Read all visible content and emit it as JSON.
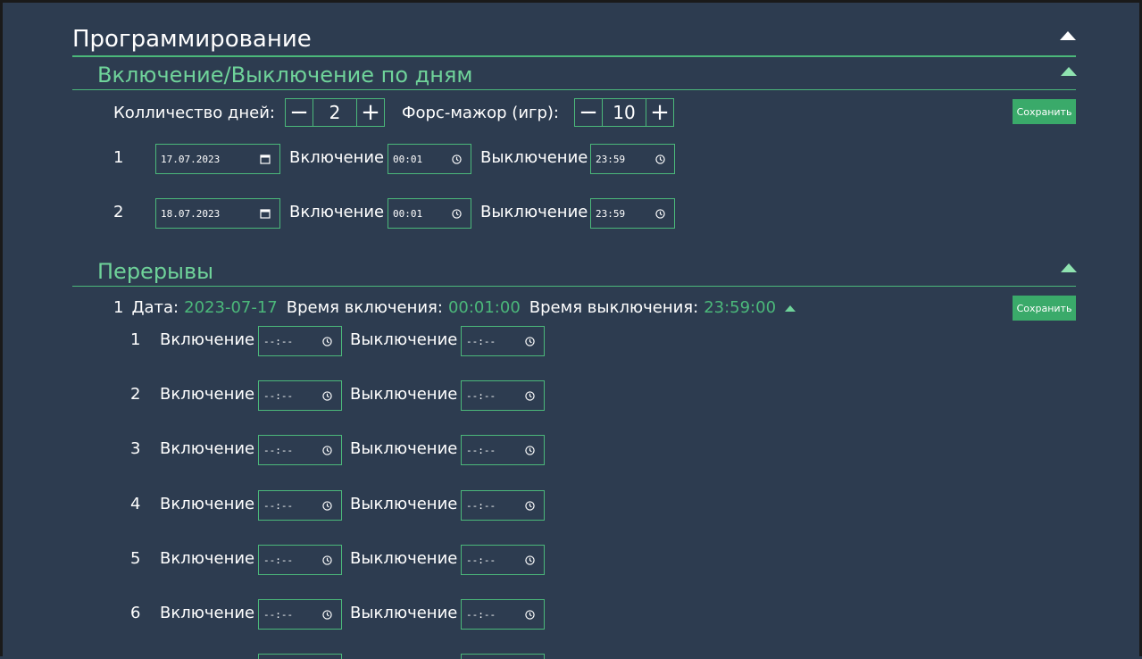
{
  "page_title": "Программирование",
  "onoff_section": {
    "title": "Включение/Выключение по дням",
    "days_count_label": "Колличество дней:",
    "days_count_value": "2",
    "force_label": "Форс-мажор (игр):",
    "force_value": "10",
    "minus_symbol": "−",
    "plus_symbol": "+",
    "save_label": "Сохранить",
    "on_label": "Включение",
    "off_label": "Выключение",
    "rows": [
      {
        "index": "1",
        "date": "17.07.2023",
        "on_time": "00:01",
        "off_time": "23:59"
      },
      {
        "index": "2",
        "date": "18.07.2023",
        "on_time": "00:01",
        "off_time": "23:59"
      }
    ]
  },
  "breaks_section": {
    "title": "Перерывы",
    "save_label": "Сохранить",
    "day": {
      "index": "1",
      "date_key": "Дата:",
      "date_value": "2023-07-17",
      "on_key": "Время включения:",
      "on_value": "00:01:00",
      "off_key": "Время выключения:",
      "off_value": "23:59:00"
    },
    "on_label": "Включение",
    "off_label": "Выключение",
    "empty_time": "--:--",
    "rows": [
      {
        "index": "1"
      },
      {
        "index": "2"
      },
      {
        "index": "3"
      },
      {
        "index": "4"
      },
      {
        "index": "5"
      },
      {
        "index": "6"
      }
    ]
  },
  "colors": {
    "background": "#2d3c50",
    "accent": "#4bb87a",
    "accent_text": "#6fd39a",
    "button": "#3aaa6a"
  },
  "icons": {
    "collapse": "triangle-up-icon",
    "calendar": "calendar-icon",
    "clock": "clock-icon"
  }
}
